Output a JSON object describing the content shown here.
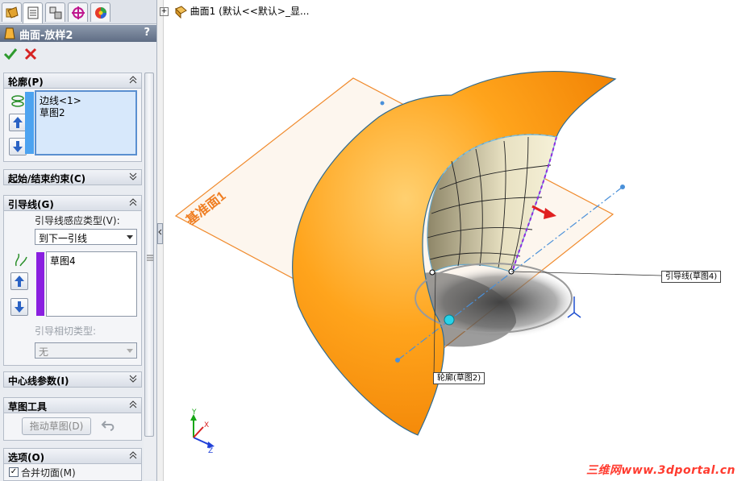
{
  "property_manager": {
    "title": "曲面-放样2",
    "help": "?",
    "tabs": [
      "feature-manager-tab",
      "property-manager-tab",
      "configuration-manager-tab",
      "dimxpert-tab",
      "appearance-tab"
    ]
  },
  "profile_group": {
    "title": "轮廓(P)",
    "items": [
      "边线<1>",
      "草图2"
    ]
  },
  "start_end_group": {
    "title": "起始/结束约束(C)"
  },
  "guide_group": {
    "title": "引导线(G)",
    "influence_label": "引导线感应类型(V):",
    "influence_value": "到下一引线",
    "items": [
      "草图4"
    ],
    "tangency_label": "引导相切类型:",
    "tangency_value": "无"
  },
  "centerline_group": {
    "title": "中心线参数(I)"
  },
  "sketch_tools_group": {
    "title": "草图工具",
    "drag_button": "拖动草图(D)"
  },
  "options_group": {
    "title": "选项(O)",
    "merge_label": "合并切面(M)",
    "merge_checked": true
  },
  "feature_tree": {
    "expand": "+",
    "label": "曲面1 (默认<<默认>_显..."
  },
  "viewport": {
    "plane_label": "基准面1",
    "callout_guide": "引导线(草图4)",
    "callout_profile": "轮廓(草图2)",
    "watermark": "三维网www.3dportal.cn",
    "colors": {
      "surface": "#ff9a16",
      "plane": "#f08a2c",
      "guide": "#8a2be2",
      "accent_blue": "#2a7fd4"
    }
  }
}
